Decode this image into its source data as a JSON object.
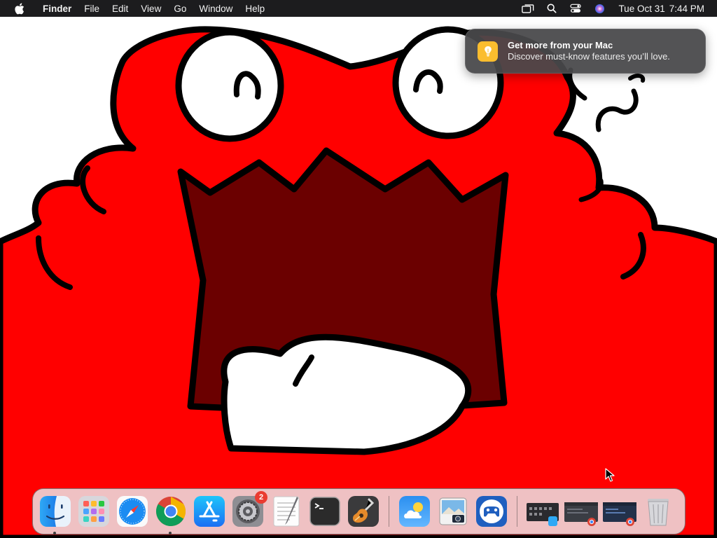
{
  "colors": {
    "menubar_bg": "#1c1c1e",
    "wallpaper_red": "#ff0000",
    "mouth_dark": "#6b0000",
    "notification_bg": "#48484a",
    "badge_red": "#ea3b31"
  },
  "menubar": {
    "apple_icon": "apple-logo-icon",
    "app_name": "Finder",
    "menus": [
      "File",
      "Edit",
      "View",
      "Go",
      "Window",
      "Help"
    ],
    "status_icons": [
      "screen-mirroring-icon",
      "spotlight-search-icon",
      "control-center-icon",
      "siri-icon"
    ],
    "clock": {
      "date": "Tue Oct 31",
      "time": "7:44 PM"
    }
  },
  "notification": {
    "icon": "tips-lightbulb-icon",
    "title": "Get more from your Mac",
    "body": "Discover must-know features you’ll love."
  },
  "dock": {
    "apps": [
      {
        "name": "Finder",
        "icon": "finder-icon",
        "running": true
      },
      {
        "name": "Launchpad",
        "icon": "launchpad-icon",
        "running": false
      },
      {
        "name": "Safari",
        "icon": "safari-icon",
        "running": false
      },
      {
        "name": "Google Chrome",
        "icon": "chrome-icon",
        "running": true
      },
      {
        "name": "App Store",
        "icon": "app-store-icon",
        "running": false
      },
      {
        "name": "System Settings",
        "icon": "system-settings-icon",
        "running": false,
        "badge": "2"
      },
      {
        "name": "TextEdit",
        "icon": "textedit-icon",
        "running": false
      },
      {
        "name": "Terminal",
        "icon": "terminal-icon",
        "running": false
      },
      {
        "name": "GarageBand",
        "icon": "garageband-icon",
        "running": false
      }
    ],
    "recent_apps": [
      {
        "name": "Weather",
        "icon": "weather-icon"
      },
      {
        "name": "Preview",
        "icon": "preview-icon"
      },
      {
        "name": "Steam Link",
        "icon": "gamepad-icon"
      }
    ],
    "minimized_windows": [
      {
        "icon": "minimized-finder-window-icon"
      },
      {
        "icon": "minimized-chrome-window-icon"
      },
      {
        "icon": "minimized-chrome-window-icon"
      }
    ],
    "trash": {
      "name": "Trash",
      "icon": "trash-icon"
    }
  }
}
